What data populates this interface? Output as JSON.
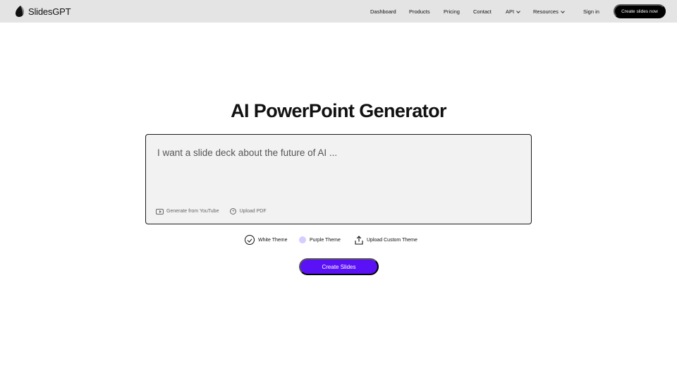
{
  "brand": {
    "name": "SlidesGPT"
  },
  "nav": {
    "items": [
      {
        "label": "Dashboard"
      },
      {
        "label": "Products"
      },
      {
        "label": "Pricing"
      },
      {
        "label": "Contact"
      },
      {
        "label": "API"
      },
      {
        "label": "Resources"
      }
    ],
    "sign_in": "Sign in",
    "cta": "Create slides now"
  },
  "main": {
    "title": "AI PowerPoint Generator",
    "prompt": {
      "placeholder": "I want a slide deck about the future of AI ...",
      "value": ""
    },
    "actions": {
      "youtube": "Generate from YouTube",
      "pdf": "Upload PDF"
    },
    "themes": {
      "white": "White Theme",
      "purple": "Purple Theme",
      "custom": "Upload Custom Theme",
      "selected": "White Theme"
    },
    "submit": "Create Slides"
  },
  "colors": {
    "topbar": "#e4e4e4",
    "accent": "#5b11f5",
    "purple_theme_swatch": "#d6ccff",
    "cta_bg": "#000000"
  }
}
